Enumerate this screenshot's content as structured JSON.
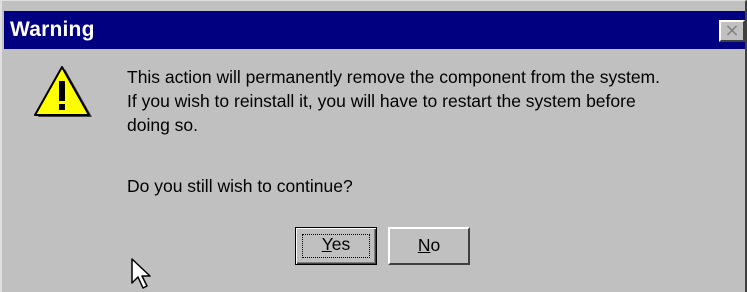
{
  "window": {
    "title": "Warning",
    "close_glyph": "×"
  },
  "message": {
    "lines": [
      "This action will permanently remove the component from the system.",
      "If you wish to reinstall it, you will have to restart the system before",
      "doing so."
    ],
    "question": "Do you still wish to continue?"
  },
  "buttons": {
    "yes": {
      "accel": "Y",
      "rest": "es"
    },
    "no": {
      "accel": "N",
      "rest": "o"
    }
  },
  "icons": {
    "warning": "warning-icon",
    "cursor": "mouse-pointer-icon"
  },
  "colors": {
    "titlebar": "#000080",
    "face": "#c0c0c0",
    "warning_fill": "#ffff00"
  }
}
